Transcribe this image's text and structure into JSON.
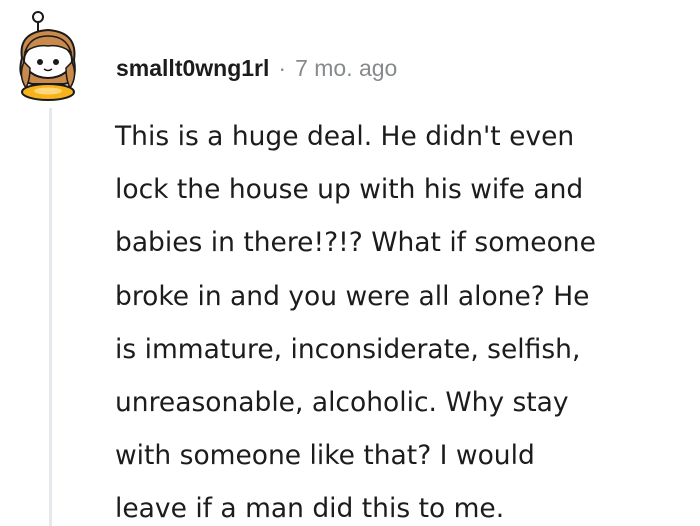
{
  "comment": {
    "username": "smallt0wng1rl",
    "separator": "·",
    "time_ago": "7 mo. ago",
    "avatar_icon": "snoo-avatar-icon",
    "body_lines": [
      "This is a huge deal. He didn't even",
      "lock the house up with his wife and",
      "babies in there!?!? What if someone",
      "broke in and you were all alone? He",
      "is immature, inconsiderate, selfish,",
      "unreasonable, alcoholic. Why stay",
      "with someone like that? I would",
      "leave if a man did this to me."
    ]
  },
  "colors": {
    "text": "#1c1c1c",
    "meta": "#878a8c",
    "thread_line": "#e6e9eb"
  }
}
